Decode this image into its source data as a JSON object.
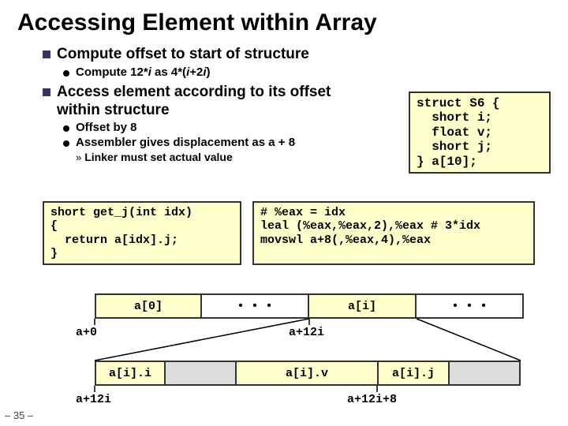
{
  "title": "Accessing Element within Array",
  "b1": "Compute offset to start of structure",
  "b1s1_a": "Compute 12*",
  "b1s1_b": "i",
  "b1s1_c": " as 4*(",
  "b1s1_d": "i",
  "b1s1_e": "+2",
  "b1s1_f": "i",
  "b1s1_g": ")",
  "b2": "Access element according to its offset within structure",
  "b2s1": "Offset by 8",
  "b2s2": "Assembler gives displacement as a + 8",
  "b2s2a": "Linker must set actual value",
  "struct_code": "struct S6 {\n  short i;\n  float v;\n  short j;\n} a[10];",
  "code_left": "short get_j(int idx)\n{\n  return a[idx].j;\n}",
  "code_right": "# %eax = idx\nleal (%eax,%eax,2),%eax # 3*idx\nmovswl a+8(,%eax,4),%eax",
  "d1_c0": "a[0]",
  "d1_c1": "• • •",
  "d1_c2": "a[i]",
  "d1_c3": "• • •",
  "p1_left": "a+0",
  "p1_right": "a+12i",
  "d2_c0": "a[i].i",
  "d2_c2": "a[i].v",
  "d2_c3": "a[i].j",
  "p2_left": "a+12i",
  "p2_right": "a+12i+8",
  "slide": "– 35 –"
}
